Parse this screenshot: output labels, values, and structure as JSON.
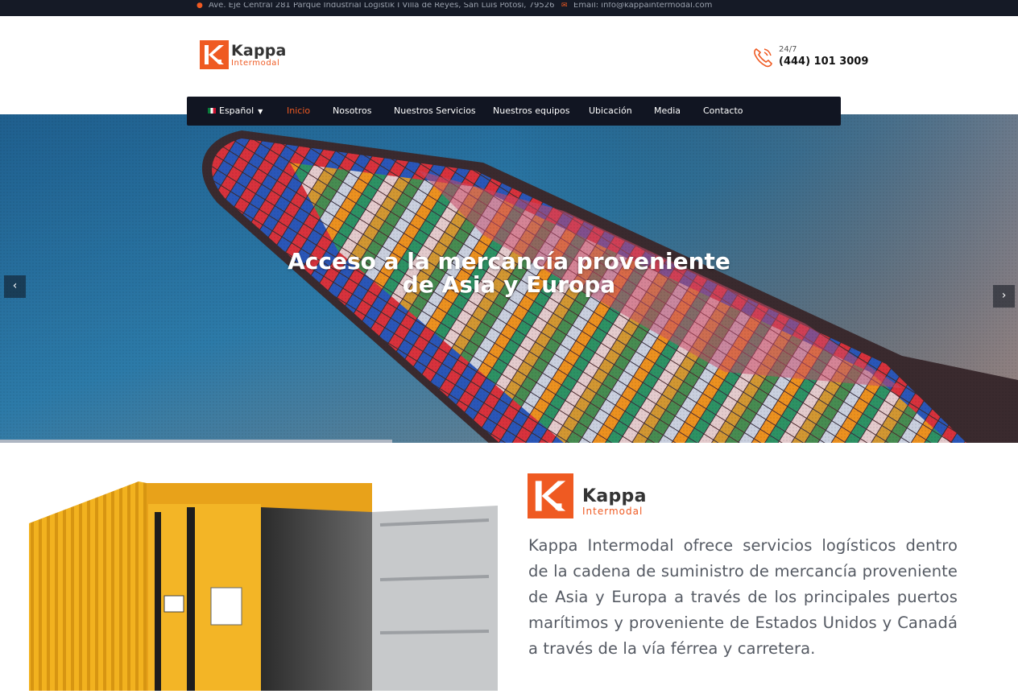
{
  "topbar": {
    "address": "Ave. Eje Central 281 Parque Industrial Logistik I Villa de Reyes, San Luis Potosí, 79526",
    "address_icon": "map-pin-icon",
    "email": "Email: info@kappaintermodal.com",
    "email_icon": "envelope-icon"
  },
  "brand": {
    "name": "Kappa",
    "sub": "Intermodal",
    "accent": "#ef5a22"
  },
  "contact": {
    "hours": "24/7",
    "phone": "(444) 101 3009",
    "phone_icon": "phone-icon"
  },
  "nav": {
    "language": "Español",
    "items": [
      "Inicio",
      "Nosotros",
      "Nuestros Servicios",
      "Nuestros equipos",
      "Ubicación",
      "Media",
      "Contacto"
    ],
    "active": "Inicio"
  },
  "hero": {
    "title_line1": "Acceso a la mercancía proveniente",
    "title_line2": "de Asia y Europa",
    "prev_icon": "chevron-left-icon",
    "next_icon": "chevron-right-icon",
    "progress": 0.385
  },
  "about": {
    "text": "Kappa Intermodal ofrece servicios logísticos dentro de la cadena de suministro de mercancía proveniente de Asia y Europa a través de los principales puertos marítimos y proveniente de Estados Unidos y Canadá a través de la vía férrea y carretera."
  }
}
